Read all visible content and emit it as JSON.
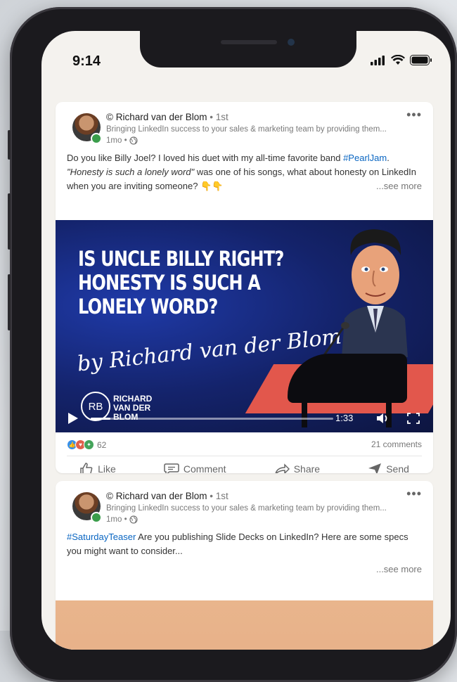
{
  "status": {
    "time": "9:14"
  },
  "posts": [
    {
      "author": "© Richard van der Blom",
      "degree": "• 1st",
      "tagline": "Bringing LinkedIn success to your sales & marketing team by providing them...",
      "time": "1mo •",
      "text_1": "Do you like Billy Joel? I loved his duet with my all-time favorite band ",
      "hashtag": "#PearlJam",
      "text_2": ".",
      "quote": "\"Honesty is such a lonely word\"",
      "text_3": " was one of his songs, what about honesty on LinkedIn when you are inviting someone? 👇👇",
      "see_more": "...see more",
      "media": {
        "title": "IS UNCLE BILLY RIGHT? HONESTY IS SUCH A LONELY WORD?",
        "byline": "by Richard van der Blom",
        "logo_initials": "RB",
        "logo_text": "RICHARD VAN DER BLOM",
        "duration": "1:33",
        "progress": 0.08
      },
      "reactions_count": "62",
      "comments": "21 comments",
      "actions": [
        "Like",
        "Comment",
        "Share",
        "Send"
      ]
    },
    {
      "author": "© Richard van der Blom",
      "degree": "• 1st",
      "tagline": "Bringing LinkedIn success to your sales & marketing team by providing them...",
      "time": "1mo •",
      "hashtag": "#SaturdayTeaser",
      "text_1": " Are you publishing Slide Decks on LinkedIn? Here are some specs you might want to consider...",
      "see_more": "...see more"
    }
  ],
  "colors": {
    "link": "#0a66c2",
    "online": "#3a9d4b",
    "accent_red": "#e2574c"
  }
}
